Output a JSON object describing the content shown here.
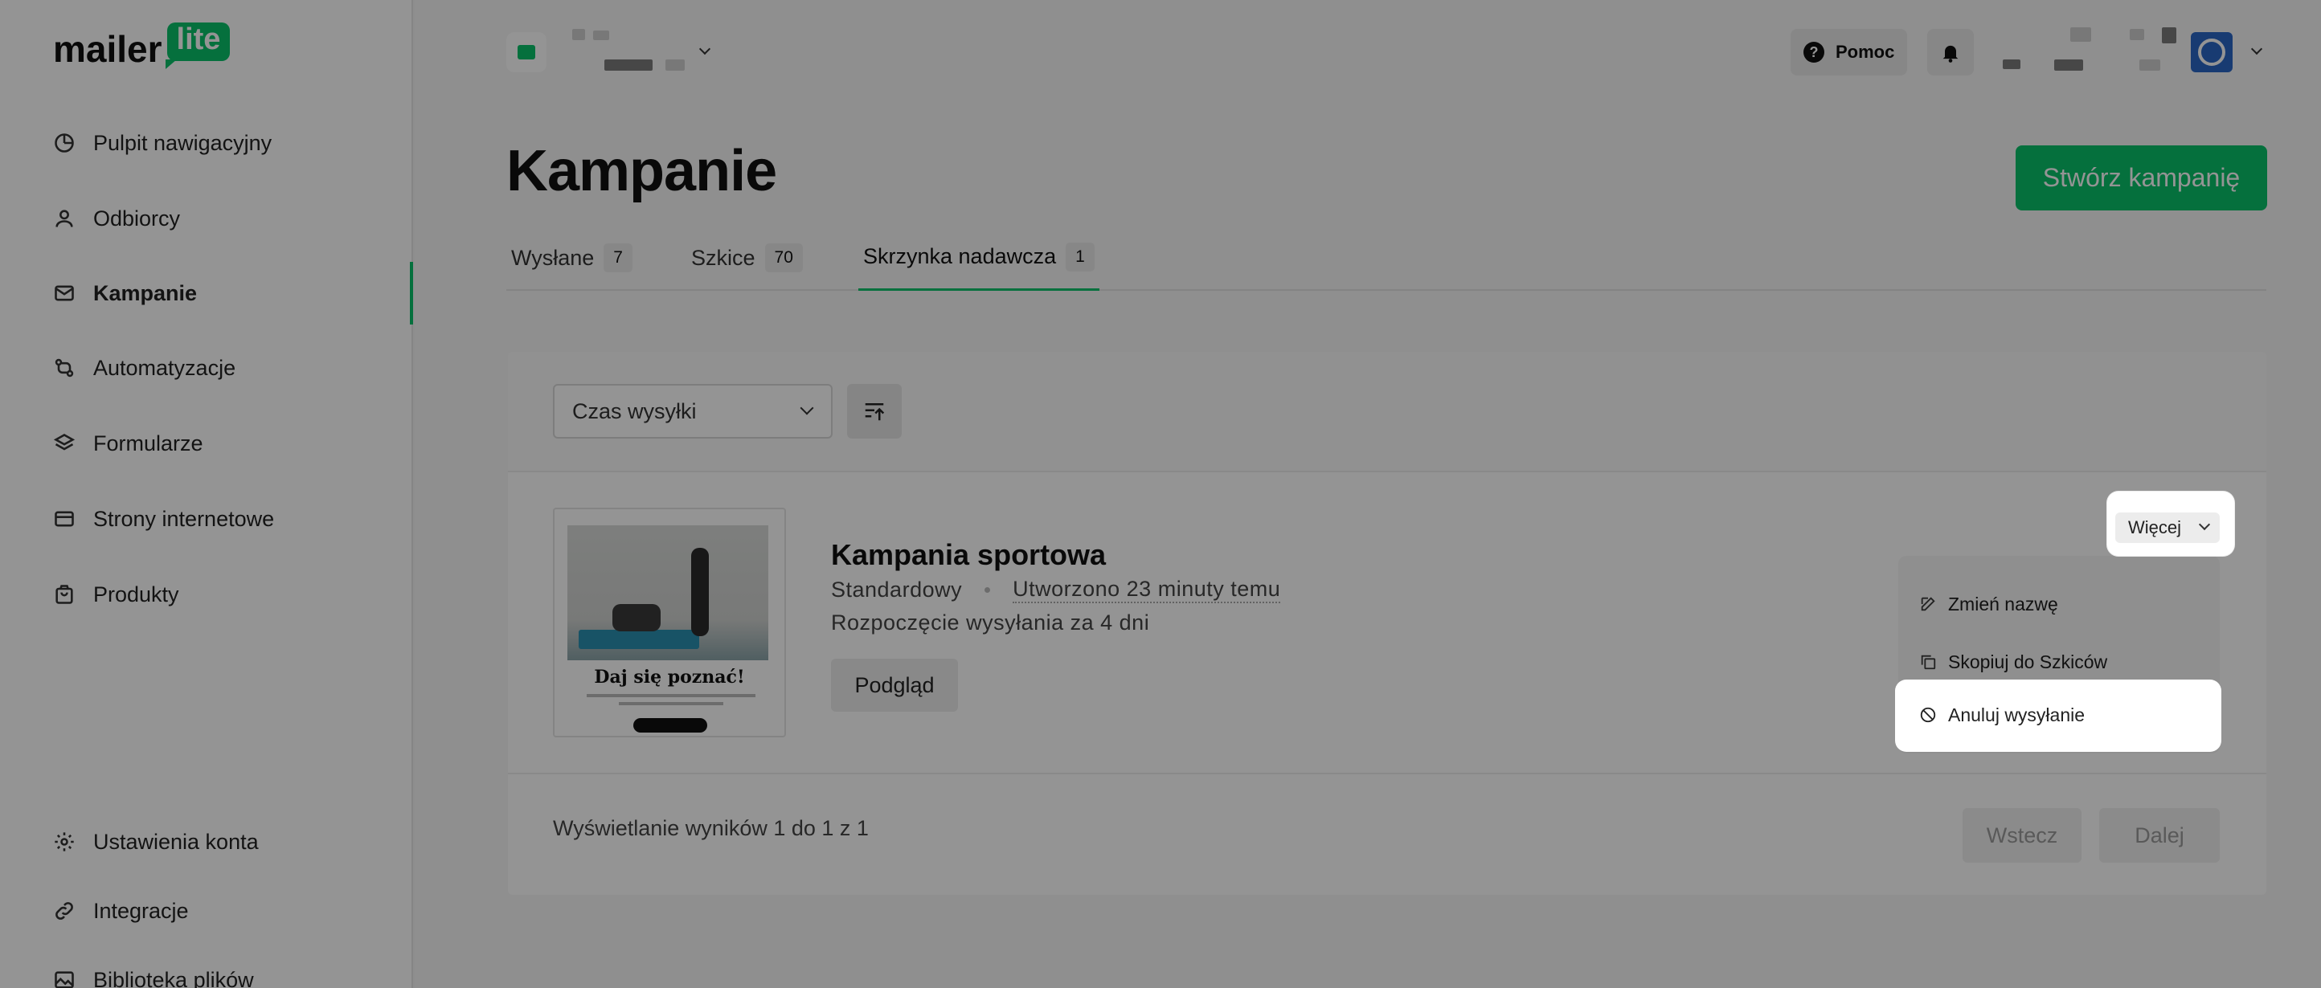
{
  "logo": {
    "text": "mailer",
    "badge": "lite"
  },
  "sidebar": {
    "items": [
      {
        "label": "Pulpit nawigacyjny"
      },
      {
        "label": "Odbiorcy"
      },
      {
        "label": "Kampanie"
      },
      {
        "label": "Automatyzacje"
      },
      {
        "label": "Formularze"
      },
      {
        "label": "Strony internetowe"
      },
      {
        "label": "Produkty"
      }
    ],
    "bottom_items": [
      {
        "label": "Ustawienia konta"
      },
      {
        "label": "Integracje"
      },
      {
        "label": "Biblioteka plików"
      }
    ]
  },
  "header": {
    "help_label": "Pomoc",
    "help_icon": "?"
  },
  "page": {
    "title": "Kampanie",
    "create_label": "Stwórz kampanię"
  },
  "tabs": [
    {
      "label": "Wysłane",
      "count": "7"
    },
    {
      "label": "Szkice",
      "count": "70"
    },
    {
      "label": "Skrzynka nadawcza",
      "count": "1"
    }
  ],
  "filters": {
    "sort_select": "Czas wysyłki"
  },
  "campaign": {
    "title": "Kampania sportowa",
    "type": "Standardowy",
    "created": "Utworzono 23 minuty temu",
    "schedule": "Rozpoczęcie wysyłania za 4 dni",
    "preview_label": "Podgląd",
    "thumbnail_title": "Daj się poznać!",
    "more_label": "Więcej"
  },
  "dropdown": {
    "rename": "Zmień nazwę",
    "copy": "Skopiuj do Szkiców",
    "cancel": "Anuluj wysyłanie"
  },
  "pagination": {
    "summary": "Wyświetlanie wyników 1 do 1 z 1",
    "back": "Wstecz",
    "next": "Dalej"
  },
  "colors": {
    "accent": "#09c269",
    "avatar": "#2a66c4"
  }
}
